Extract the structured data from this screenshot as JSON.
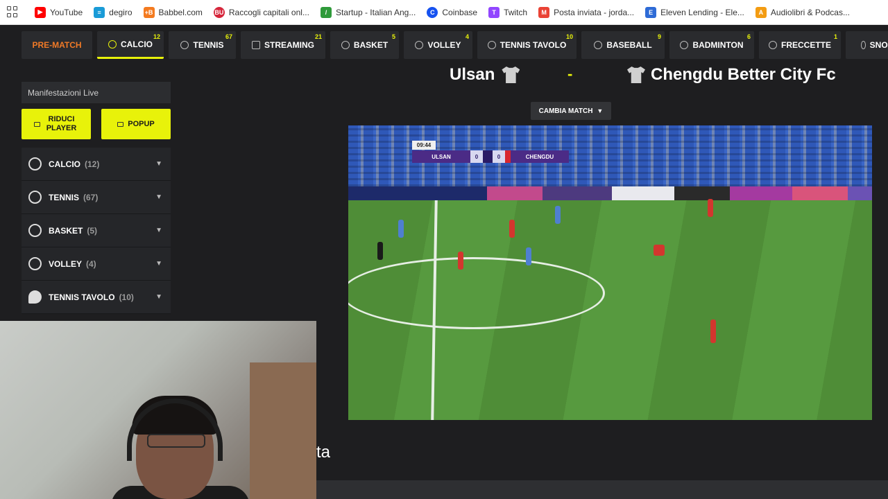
{
  "bookmarks": [
    {
      "label": "YouTube",
      "color": "#ff0000",
      "glyph": "▶"
    },
    {
      "label": "degiro",
      "color": "#1a9bd7",
      "glyph": "≡"
    },
    {
      "label": "Babbel.com",
      "color": "#f47b20",
      "glyph": "+B"
    },
    {
      "label": "Raccogli capitali onl...",
      "color": "#d6263b",
      "glyph": "BU"
    },
    {
      "label": "Startup - Italian Ang...",
      "color": "#2f9a3a",
      "glyph": "/"
    },
    {
      "label": "Coinbase",
      "color": "#1652f0",
      "glyph": "C"
    },
    {
      "label": "Twitch",
      "color": "#9146ff",
      "glyph": "T"
    },
    {
      "label": "Posta inviata - jorda...",
      "color": "#ea4335",
      "glyph": "M"
    },
    {
      "label": "Eleven Lending - Ele...",
      "color": "#2e6bd6",
      "glyph": "E"
    },
    {
      "label": "Audiolibri & Podcas...",
      "color": "#f39c12",
      "glyph": "A"
    }
  ],
  "sport_nav": [
    {
      "label": "PRE-MATCH",
      "count": ""
    },
    {
      "label": "CALCIO",
      "count": "12"
    },
    {
      "label": "TENNIS",
      "count": "67"
    },
    {
      "label": "STREAMING",
      "count": "21"
    },
    {
      "label": "BASKET",
      "count": "5"
    },
    {
      "label": "VOLLEY",
      "count": "4"
    },
    {
      "label": "TENNIS TAVOLO",
      "count": "10"
    },
    {
      "label": "BASEBALL",
      "count": "9"
    },
    {
      "label": "BADMINTON",
      "count": "6"
    },
    {
      "label": "FRECCETTE",
      "count": "1"
    },
    {
      "label": "SNOO",
      "count": ""
    }
  ],
  "sidebar": {
    "header": "Manifestazioni Live",
    "reduce_button": "RIDUCI PLAYER",
    "popup_button": "POPUP",
    "sports": [
      {
        "label": "CALCIO",
        "count": "(12)",
        "icon": "soccer-ball-icon"
      },
      {
        "label": "TENNIS",
        "count": "(67)",
        "icon": "tennis-ball-icon"
      },
      {
        "label": "BASKET",
        "count": "(5)",
        "icon": "basketball-icon"
      },
      {
        "label": "VOLLEY",
        "count": "(4)",
        "icon": "volleyball-icon"
      },
      {
        "label": "TENNIS TAVOLO",
        "count": "(10)",
        "icon": "ping-pong-icon"
      }
    ]
  },
  "match": {
    "home_team": "Ulsan",
    "separator": "-",
    "away_team": "Chengdu Better City Fc",
    "change_match": "CAMBIA MATCH",
    "video": {
      "clock": "09:44",
      "home_short": "ULSAN",
      "away_short": "CHENGDU",
      "home_score": "0",
      "away_score": "0"
    }
  },
  "overlay_text": "ta",
  "colors": {
    "accent": "#e8f20a",
    "prematch": "#f07a27"
  }
}
